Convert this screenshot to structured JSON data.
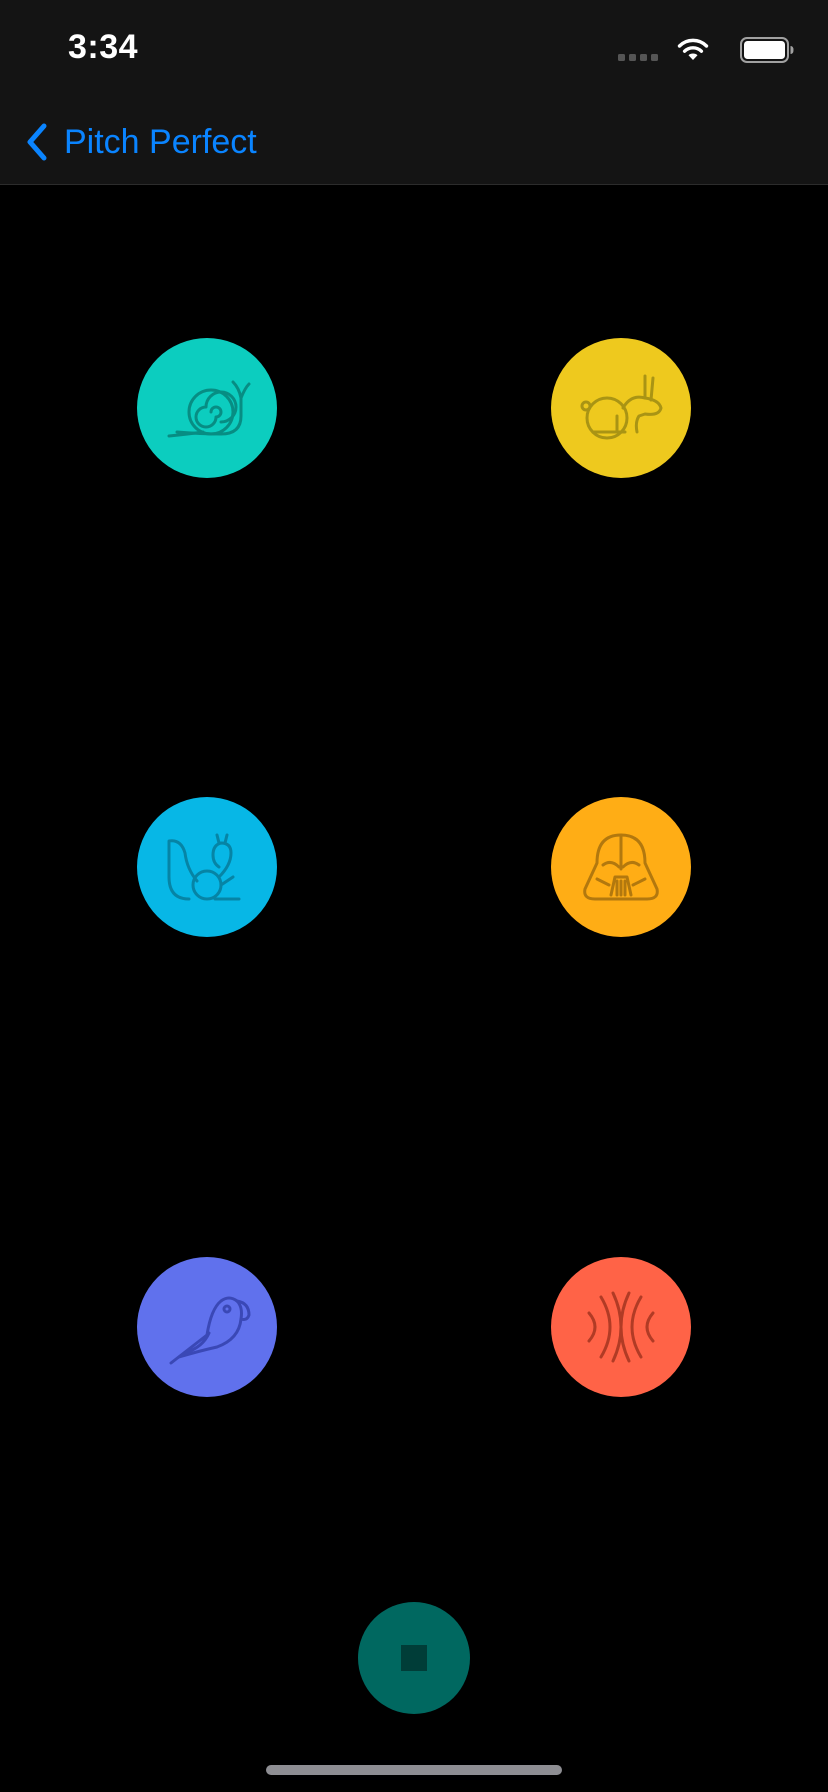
{
  "status_bar": {
    "time": "3:34",
    "signal_icon": "cellular-signal-icon",
    "wifi_icon": "wifi-icon",
    "battery_icon": "battery-full-icon"
  },
  "nav": {
    "back_label": "Pitch Perfect",
    "back_icon": "chevron-left-icon",
    "tint_color": "#0a84ff"
  },
  "effects": [
    {
      "name": "slow",
      "icon": "snail-icon",
      "color": "#0ccdbf"
    },
    {
      "name": "fast",
      "icon": "rabbit-icon",
      "color": "#eec91e"
    },
    {
      "name": "chipmunk",
      "icon": "squirrel-icon",
      "color": "#07b7e6"
    },
    {
      "name": "vader",
      "icon": "darth-vader-icon",
      "color": "#ffad15"
    },
    {
      "name": "echo",
      "icon": "parrot-icon",
      "color": "#6071ed"
    },
    {
      "name": "reverb",
      "icon": "reverb-waves-icon",
      "color": "#ff6347"
    }
  ],
  "stop_button": {
    "icon": "stop-icon",
    "color": "#006860"
  }
}
